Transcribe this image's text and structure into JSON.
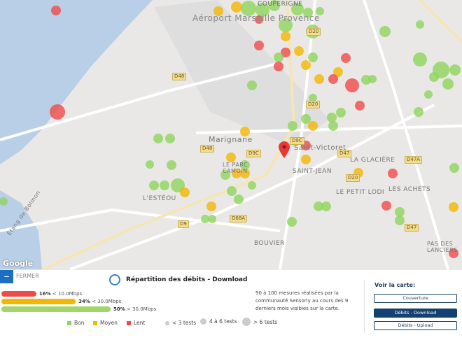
{
  "map": {
    "labels": {
      "airport": "Aéroport Marseille Provence",
      "couperigne": "COUPERIGNE",
      "marignane": "Marignane",
      "saint_victoret": "Saint-Victoret",
      "le_parc_camoin": "LE PARC CAMOIN",
      "saint_jean": "SAINT-JEAN",
      "la_glaciere": "LA GLACIÈRE",
      "le_petit_lodi": "LE PETIT LODI",
      "les_achets": "LES ACHETS",
      "l_esteou": "L'ESTÉOU",
      "bouvier": "BOUVIER",
      "pas_des_lanciers": "PAS DES LANCIERS",
      "etang": "Étang de Bolmon",
      "d48": "D48",
      "d9c": "D9C",
      "d20": "D20",
      "d47": "D47",
      "d47a": "D47A",
      "d9": "D9",
      "d68a": "D68A"
    },
    "attribution": "Google"
  },
  "panel": {
    "close_label": "FERMER",
    "title": "Répartition des débits - Download",
    "bars": [
      {
        "pct_text": "16%",
        "range": "< 10.0Mbps",
        "value": 16,
        "color": "#f04a4a"
      },
      {
        "pct_text": "34%",
        "range": "< 30.0Mbps",
        "value": 34,
        "color": "#f2b705"
      },
      {
        "pct_text": "50%",
        "range": "> 30.0Mbps",
        "value": 50,
        "color": "#a3d669"
      }
    ],
    "legend": {
      "bon": "Bon",
      "moyen": "Moyen",
      "lent": "Lent",
      "small": "< 3 tests",
      "medium": "4 à 6 tests",
      "large": "> 6 tests"
    },
    "colors": {
      "bon": "#8fd45c",
      "moyen": "#f2b705",
      "lent": "#f04a4a"
    },
    "description": "90 à 100 mesures réalisées par la communauté Sensorly au cours des 9 derniers mois visibles sur la carte.",
    "voir_label": "Voir la carte:",
    "buttons": {
      "couverture": "Couverture",
      "download": "Débits - Download",
      "upload": "Débits - Upload"
    }
  }
}
